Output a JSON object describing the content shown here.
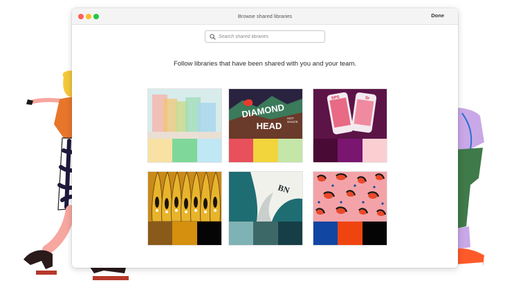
{
  "window": {
    "title": "Browse shared libraries",
    "done_label": "Done"
  },
  "search": {
    "placeholder": "Search shared libraries"
  },
  "heading": "Follow libraries that have been shared with you and your team.",
  "libraries": [
    {
      "art": "glass-panels",
      "swatches": [
        "#f8e1a3",
        "#7fd89a",
        "#bfe7f4"
      ]
    },
    {
      "art": "diamond-head",
      "art_text": [
        "DIAMOND",
        "HOT",
        "SAUCE",
        "HEAD"
      ],
      "swatches": [
        "#e8505b",
        "#f2d43c",
        "#c4e6a8"
      ]
    },
    {
      "art": "phones",
      "art_text": [
        "SPS",
        "Sr"
      ],
      "swatches": [
        "#4a0a36",
        "#7a1570",
        "#fbcfd2"
      ]
    },
    {
      "art": "feathers",
      "swatches": [
        "#8a5a1a",
        "#d4900e",
        "#050505"
      ]
    },
    {
      "art": "paper-fold",
      "art_text": [
        "BN"
      ],
      "swatches": [
        "#7fb2b4",
        "#3c6868",
        "#163e46"
      ]
    },
    {
      "art": "leopard",
      "swatches": [
        "#1146a3",
        "#f04410",
        "#050505"
      ]
    }
  ],
  "colors": {
    "titlebar": "#f4f4f4",
    "dot_red": "#ff5f57",
    "dot_yellow": "#febc2e",
    "dot_green": "#28c840"
  }
}
